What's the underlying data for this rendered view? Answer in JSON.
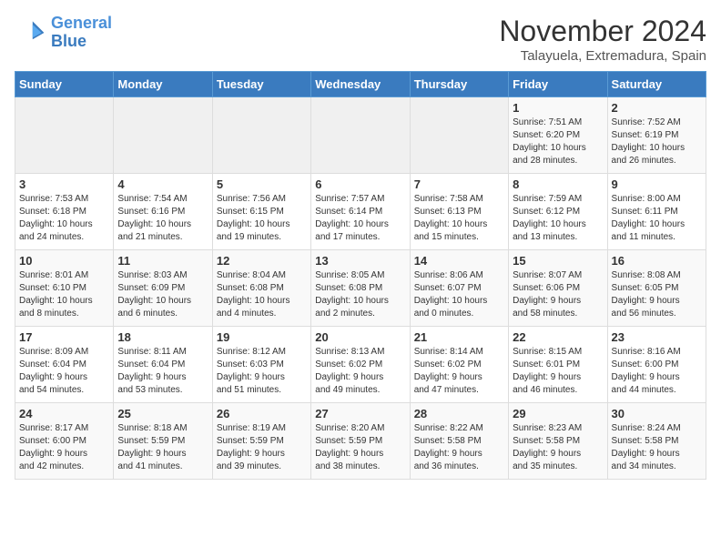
{
  "header": {
    "logo_line1": "General",
    "logo_line2": "Blue",
    "month_title": "November 2024",
    "location": "Talayuela, Extremadura, Spain"
  },
  "weekdays": [
    "Sunday",
    "Monday",
    "Tuesday",
    "Wednesday",
    "Thursday",
    "Friday",
    "Saturday"
  ],
  "weeks": [
    [
      {
        "day": "",
        "info": ""
      },
      {
        "day": "",
        "info": ""
      },
      {
        "day": "",
        "info": ""
      },
      {
        "day": "",
        "info": ""
      },
      {
        "day": "",
        "info": ""
      },
      {
        "day": "1",
        "info": "Sunrise: 7:51 AM\nSunset: 6:20 PM\nDaylight: 10 hours\nand 28 minutes."
      },
      {
        "day": "2",
        "info": "Sunrise: 7:52 AM\nSunset: 6:19 PM\nDaylight: 10 hours\nand 26 minutes."
      }
    ],
    [
      {
        "day": "3",
        "info": "Sunrise: 7:53 AM\nSunset: 6:18 PM\nDaylight: 10 hours\nand 24 minutes."
      },
      {
        "day": "4",
        "info": "Sunrise: 7:54 AM\nSunset: 6:16 PM\nDaylight: 10 hours\nand 21 minutes."
      },
      {
        "day": "5",
        "info": "Sunrise: 7:56 AM\nSunset: 6:15 PM\nDaylight: 10 hours\nand 19 minutes."
      },
      {
        "day": "6",
        "info": "Sunrise: 7:57 AM\nSunset: 6:14 PM\nDaylight: 10 hours\nand 17 minutes."
      },
      {
        "day": "7",
        "info": "Sunrise: 7:58 AM\nSunset: 6:13 PM\nDaylight: 10 hours\nand 15 minutes."
      },
      {
        "day": "8",
        "info": "Sunrise: 7:59 AM\nSunset: 6:12 PM\nDaylight: 10 hours\nand 13 minutes."
      },
      {
        "day": "9",
        "info": "Sunrise: 8:00 AM\nSunset: 6:11 PM\nDaylight: 10 hours\nand 11 minutes."
      }
    ],
    [
      {
        "day": "10",
        "info": "Sunrise: 8:01 AM\nSunset: 6:10 PM\nDaylight: 10 hours\nand 8 minutes."
      },
      {
        "day": "11",
        "info": "Sunrise: 8:03 AM\nSunset: 6:09 PM\nDaylight: 10 hours\nand 6 minutes."
      },
      {
        "day": "12",
        "info": "Sunrise: 8:04 AM\nSunset: 6:08 PM\nDaylight: 10 hours\nand 4 minutes."
      },
      {
        "day": "13",
        "info": "Sunrise: 8:05 AM\nSunset: 6:08 PM\nDaylight: 10 hours\nand 2 minutes."
      },
      {
        "day": "14",
        "info": "Sunrise: 8:06 AM\nSunset: 6:07 PM\nDaylight: 10 hours\nand 0 minutes."
      },
      {
        "day": "15",
        "info": "Sunrise: 8:07 AM\nSunset: 6:06 PM\nDaylight: 9 hours\nand 58 minutes."
      },
      {
        "day": "16",
        "info": "Sunrise: 8:08 AM\nSunset: 6:05 PM\nDaylight: 9 hours\nand 56 minutes."
      }
    ],
    [
      {
        "day": "17",
        "info": "Sunrise: 8:09 AM\nSunset: 6:04 PM\nDaylight: 9 hours\nand 54 minutes."
      },
      {
        "day": "18",
        "info": "Sunrise: 8:11 AM\nSunset: 6:04 PM\nDaylight: 9 hours\nand 53 minutes."
      },
      {
        "day": "19",
        "info": "Sunrise: 8:12 AM\nSunset: 6:03 PM\nDaylight: 9 hours\nand 51 minutes."
      },
      {
        "day": "20",
        "info": "Sunrise: 8:13 AM\nSunset: 6:02 PM\nDaylight: 9 hours\nand 49 minutes."
      },
      {
        "day": "21",
        "info": "Sunrise: 8:14 AM\nSunset: 6:02 PM\nDaylight: 9 hours\nand 47 minutes."
      },
      {
        "day": "22",
        "info": "Sunrise: 8:15 AM\nSunset: 6:01 PM\nDaylight: 9 hours\nand 46 minutes."
      },
      {
        "day": "23",
        "info": "Sunrise: 8:16 AM\nSunset: 6:00 PM\nDaylight: 9 hours\nand 44 minutes."
      }
    ],
    [
      {
        "day": "24",
        "info": "Sunrise: 8:17 AM\nSunset: 6:00 PM\nDaylight: 9 hours\nand 42 minutes."
      },
      {
        "day": "25",
        "info": "Sunrise: 8:18 AM\nSunset: 5:59 PM\nDaylight: 9 hours\nand 41 minutes."
      },
      {
        "day": "26",
        "info": "Sunrise: 8:19 AM\nSunset: 5:59 PM\nDaylight: 9 hours\nand 39 minutes."
      },
      {
        "day": "27",
        "info": "Sunrise: 8:20 AM\nSunset: 5:59 PM\nDaylight: 9 hours\nand 38 minutes."
      },
      {
        "day": "28",
        "info": "Sunrise: 8:22 AM\nSunset: 5:58 PM\nDaylight: 9 hours\nand 36 minutes."
      },
      {
        "day": "29",
        "info": "Sunrise: 8:23 AM\nSunset: 5:58 PM\nDaylight: 9 hours\nand 35 minutes."
      },
      {
        "day": "30",
        "info": "Sunrise: 8:24 AM\nSunset: 5:58 PM\nDaylight: 9 hours\nand 34 minutes."
      }
    ]
  ]
}
